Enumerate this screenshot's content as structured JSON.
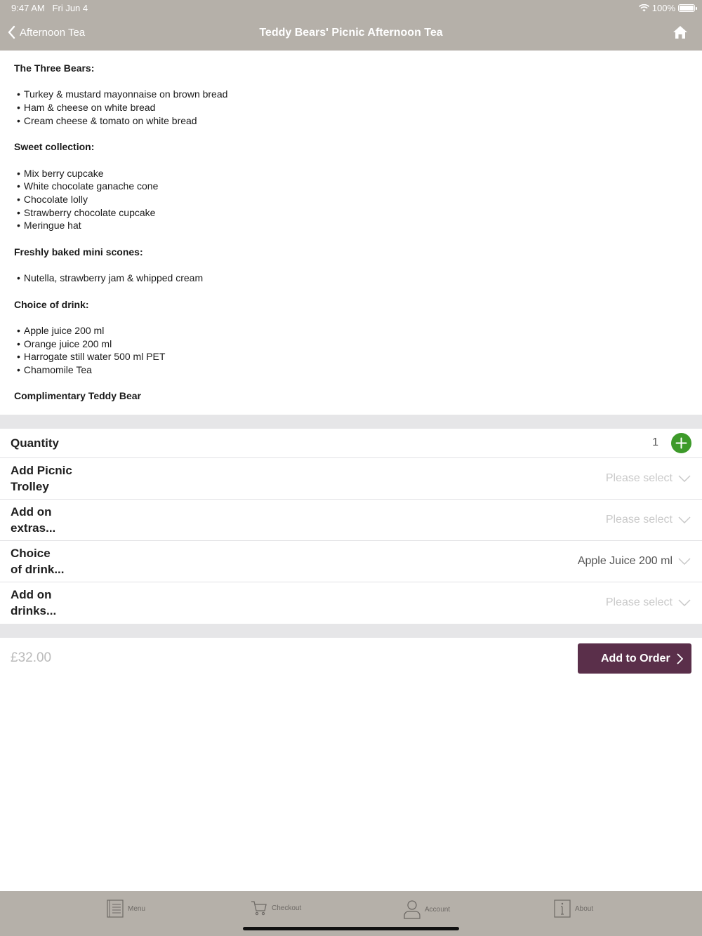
{
  "status": {
    "time": "9:47 AM",
    "date": "Fri Jun 4",
    "battery": "100%"
  },
  "nav": {
    "back_label": "Afternoon Tea",
    "title": "Teddy Bears' Picnic Afternoon Tea"
  },
  "description": {
    "sections": [
      {
        "heading": "The Three Bears:",
        "items": [
          "Turkey & mustard mayonnaise on brown bread",
          "Ham & cheese on white bread",
          "Cream cheese & tomato on white bread"
        ]
      },
      {
        "heading": "Sweet collection:",
        "items": [
          "Mix berry cupcake",
          "White chocolate ganache cone",
          "Chocolate lolly",
          "Strawberry chocolate cupcake",
          "Meringue hat"
        ]
      },
      {
        "heading": "Freshly baked mini scones:",
        "items": [
          "Nutella, strawberry jam & whipped cream"
        ]
      },
      {
        "heading": "Choice of drink:",
        "items": [
          "Apple juice 200 ml",
          "Orange juice 200 ml",
          "Harrogate still water 500 ml PET",
          "Chamomile Tea"
        ]
      }
    ],
    "footer": "Complimentary Teddy Bear"
  },
  "quantity": {
    "label": "Quantity",
    "value": "1"
  },
  "options": [
    {
      "label_line1": "Add Picnic",
      "label_line2": "Trolley",
      "value": "Please select"
    },
    {
      "label_line1": "Add on",
      "label_line2": "extras...",
      "value": "Please select"
    },
    {
      "label_line1": "Choice",
      "label_line2": "of drink...",
      "value": "Apple Juice 200 ml"
    },
    {
      "label_line1": "Add on",
      "label_line2": "drinks...",
      "value": "Please select"
    }
  ],
  "price": "£32.00",
  "add_button": "Add to Order",
  "tabs": [
    {
      "label": "Menu",
      "icon": "menu-list-icon"
    },
    {
      "label": "Checkout",
      "icon": "cart-icon"
    },
    {
      "label": "Account",
      "icon": "person-icon"
    },
    {
      "label": "About",
      "icon": "info-icon"
    }
  ],
  "colors": {
    "header": "#b5b0a9",
    "accent_button": "#5a2f4a",
    "plus_button": "#3d9a2a"
  }
}
